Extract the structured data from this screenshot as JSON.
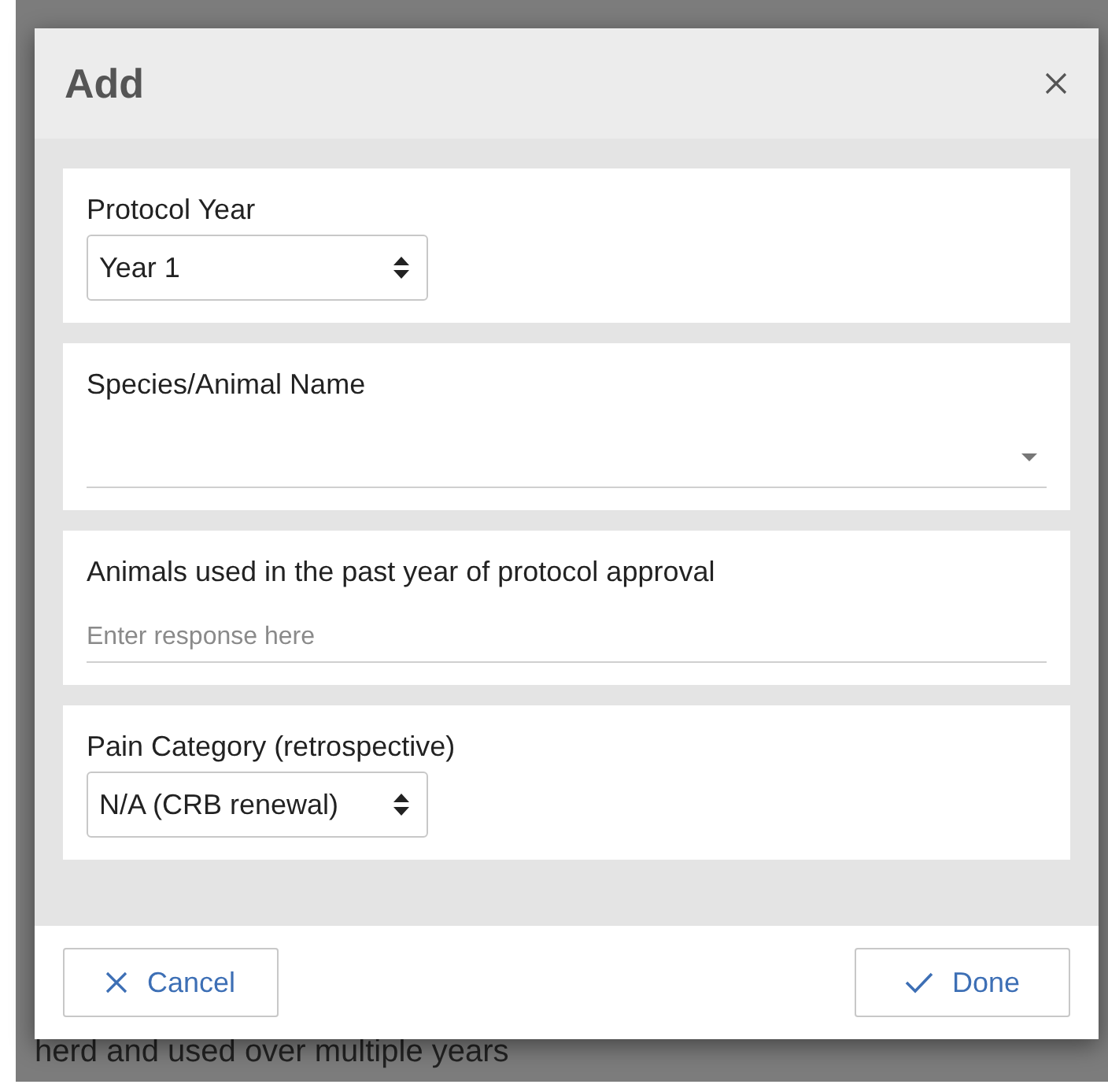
{
  "background": {
    "text": "herd and used over multiple years"
  },
  "dialog": {
    "title": "Add",
    "fields": [
      {
        "kind": "select",
        "label": "Protocol Year",
        "value": "Year 1"
      },
      {
        "kind": "dropdown",
        "label": "Species/Animal Name"
      },
      {
        "kind": "text",
        "label": "Animals used in the past year of protocol approval",
        "placeholder": "Enter response here"
      },
      {
        "kind": "select",
        "label": "Pain Category (retrospective)",
        "value": "N/A (CRB renewal)"
      }
    ],
    "buttons": [
      {
        "kind": "cancel",
        "label": "Cancel"
      },
      {
        "kind": "done",
        "label": "Done"
      }
    ]
  }
}
